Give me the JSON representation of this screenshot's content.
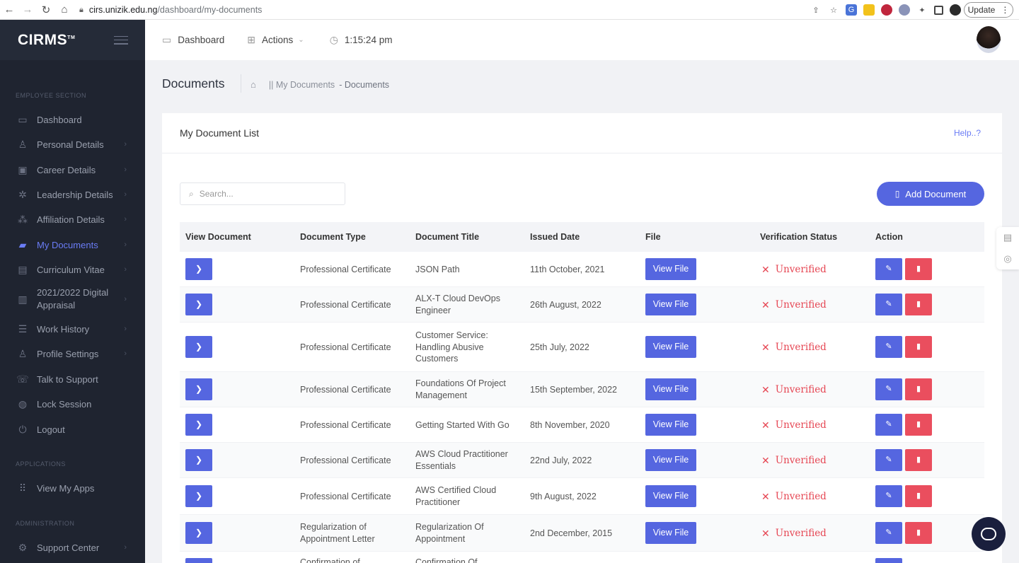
{
  "browser": {
    "url_host": "cirs.unizik.edu.ng",
    "url_path": "/dashboard/my-documents",
    "update_label": "Update"
  },
  "sidebar": {
    "logo": "CIRMS",
    "sections": {
      "employee": "EMPLOYEE SECTION",
      "applications": "APPLICATIONS",
      "administration": "ADMINISTRATION"
    },
    "items": [
      {
        "label": "Dashboard",
        "icon": "monitor-icon"
      },
      {
        "label": "Personal Details",
        "icon": "user-icon"
      },
      {
        "label": "Career Details",
        "icon": "briefcase-icon"
      },
      {
        "label": "Leadership Details",
        "icon": "network-icon"
      },
      {
        "label": "Affiliation Details",
        "icon": "nodes-icon"
      },
      {
        "label": "My Documents",
        "icon": "folder-icon",
        "active": true
      },
      {
        "label": "Curriculum Vitae",
        "icon": "id-card-icon"
      },
      {
        "label": "2021/2022 Digital Appraisal",
        "icon": "clipboard-icon"
      },
      {
        "label": "Work History",
        "icon": "list-icon"
      },
      {
        "label": "Profile Settings",
        "icon": "settings-icon"
      },
      {
        "label": "Talk to Support",
        "icon": "chat-icon"
      },
      {
        "label": "Lock Session",
        "icon": "lock-icon"
      },
      {
        "label": "Logout",
        "icon": "power-icon"
      },
      {
        "label": "View My Apps",
        "icon": "grid-icon"
      },
      {
        "label": "Support Center",
        "icon": "gear-icon"
      }
    ]
  },
  "topbar": {
    "dashboard": "Dashboard",
    "actions": "Actions",
    "time": "1:15:24 pm"
  },
  "page": {
    "title": "Documents",
    "breadcrumb_1": "|| My Documents",
    "breadcrumb_2": "- Documents"
  },
  "card": {
    "title": "My Document List",
    "help": "Help..?",
    "search_placeholder": "Search...",
    "add_button": "Add Document"
  },
  "table": {
    "headers": [
      "View Document",
      "Document Type",
      "Document Title",
      "Issued Date",
      "File",
      "Verification Status",
      "Action"
    ],
    "view_file_label": "View File",
    "rows": [
      {
        "type": "Professional Certificate",
        "title": "JSON Path",
        "date": "11th October, 2021",
        "status": "Unverified"
      },
      {
        "type": "Professional Certificate",
        "title": "ALX-T Cloud DevOps Engineer",
        "date": "26th August, 2022",
        "status": "Unverified"
      },
      {
        "type": "Professional Certificate",
        "title": "Customer Service: Handling Abusive Customers",
        "date": "25th July, 2022",
        "status": "Unverified"
      },
      {
        "type": "Professional Certificate",
        "title": "Foundations Of Project Management",
        "date": "15th September, 2022",
        "status": "Unverified"
      },
      {
        "type": "Professional Certificate",
        "title": "Getting Started With Go",
        "date": "8th November, 2020",
        "status": "Unverified"
      },
      {
        "type": "Professional Certificate",
        "title": "AWS Cloud Practitioner Essentials",
        "date": "22nd July, 2022",
        "status": "Unverified"
      },
      {
        "type": "Professional Certificate",
        "title": "AWS Certified Cloud Practitioner",
        "date": "9th August, 2022",
        "status": "Unverified"
      },
      {
        "type": "Regularization of Appointment Letter",
        "title": "Regularization Of Appointment",
        "date": "2nd December, 2015",
        "status": "Unverified"
      },
      {
        "type": "Confirmation of",
        "title": "Confirmation Of",
        "date": "",
        "status": ""
      }
    ]
  },
  "colors": {
    "sidebar_bg": "#1f2430",
    "accent": "#5566e0",
    "danger": "#ea4e5e",
    "status_unverified": "#e64653"
  }
}
